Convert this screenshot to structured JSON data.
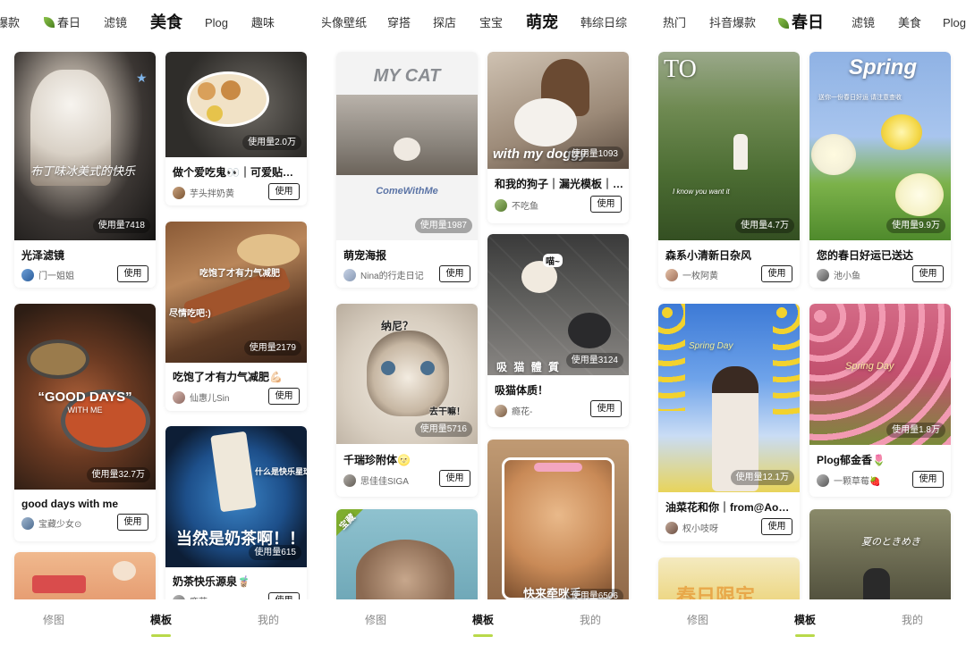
{
  "panels": [
    {
      "nav": [
        "爆款",
        "春日",
        "滤镜",
        "美食",
        "Plog",
        "趣味",
        "合照头像壁纸",
        "穿搭",
        "探店",
        "宝宝",
        "萌宠",
        "韩综日综"
      ],
      "cards": [
        {
          "title": "光泽滤镜",
          "author": "门一姐姐",
          "usage": "使用量7418",
          "overlay": "布丁味冰美式的快乐",
          "action": "使用"
        },
        {
          "title": "做个爱吃鬼👀｜可爱贴…",
          "author": "芋头拌奶黄",
          "usage": "使用量2.0万",
          "overlay": "",
          "action": "使用"
        },
        {
          "title": "good days with me",
          "author": "宝藏少女⊙",
          "usage": "使用量32.7万",
          "overlay": "“GOOD DAYS”",
          "overlay2": "WITH ME",
          "action": "使用"
        },
        {
          "title": "吃饱了才有力气减肥💪🏻",
          "author": "仙惠儿Sin",
          "usage": "使用量2179",
          "overlay": "吃饱了才有力气减肥",
          "overlay2": "尽情吃吧:)",
          "action": "使用"
        },
        {
          "title": "奶茶快乐源泉🧋",
          "author": "鹿茸",
          "usage": "使用量615",
          "overlay": "当然是奶茶啊！！",
          "overlay2": "什么是快乐星球？",
          "action": "使用"
        },
        {
          "title": "",
          "author": "",
          "usage": "",
          "overlay": "",
          "action": ""
        }
      ]
    },
    {
      "nav": [
        "热门",
        "抖音爆款",
        "春日",
        "滤镜",
        "美食",
        "Plog"
      ],
      "cards": [
        {
          "title": "萌宠海报",
          "author": "Nina的行走日记",
          "usage": "使用量1987",
          "overlay": "MY CAT",
          "overlay2": "ComeWithMe",
          "action": "使用"
        },
        {
          "title": "和我的狗子｜漏光模板｜…",
          "author": "不吃鱼",
          "usage": "使用量1093",
          "overlay": "with my doggy",
          "action": "使用"
        },
        {
          "title": "千瑞珍附体🌝",
          "author": "思佳佳SIGA",
          "usage": "使用量5716",
          "overlay": "纳尼？",
          "overlay2": "去干嘛！",
          "action": "使用"
        },
        {
          "title": "吸猫体质！",
          "author": "瘾花-",
          "usage": "使用量3124",
          "overlay": "吸 猫 體 質",
          "overlay2": "喵~",
          "action": "使用"
        },
        {
          "title": "",
          "author": "",
          "usage": "",
          "overlay": "宝藏",
          "action": ""
        },
        {
          "title": "",
          "author": "",
          "usage": "使用量6506",
          "overlay": "快来牵咪手",
          "action": ""
        }
      ]
    },
    {
      "nav": [],
      "cards": [
        {
          "title": "森系小清新日杂风",
          "author": "一枚阿黄",
          "usage": "使用量4.7万",
          "overlay": "TO",
          "overlay2": "I know you want it",
          "action": "使用"
        },
        {
          "title": "您的春日好运已送达",
          "author": "池小鱼",
          "usage": "使用量9.9万",
          "overlay": "Spring",
          "overlay2": "送你一份春日好运  请注意查收",
          "action": "使用"
        },
        {
          "title": "油菜花和你｜from@Aoo…",
          "author": "权小吱呀",
          "usage": "使用量12.1万",
          "overlay": "Spring Day",
          "action": "使用"
        },
        {
          "title": "Plog郁金香🌷",
          "author": "一颗草莓🍓",
          "usage": "使用量1.8万",
          "overlay": "Spring Day",
          "action": "使用"
        },
        {
          "title": "",
          "author": "",
          "usage": "",
          "overlay": "春日限定",
          "action": ""
        },
        {
          "title": "",
          "author": "",
          "usage": "",
          "overlay": "夏のときめき",
          "action": ""
        }
      ]
    }
  ],
  "tabbar": [
    "修图",
    "模板",
    "我的"
  ],
  "colors": {
    "accent": "#b9d94a",
    "text": "#111111",
    "muted": "#888888"
  },
  "icons": [
    "leaf-icon",
    "avatar"
  ]
}
